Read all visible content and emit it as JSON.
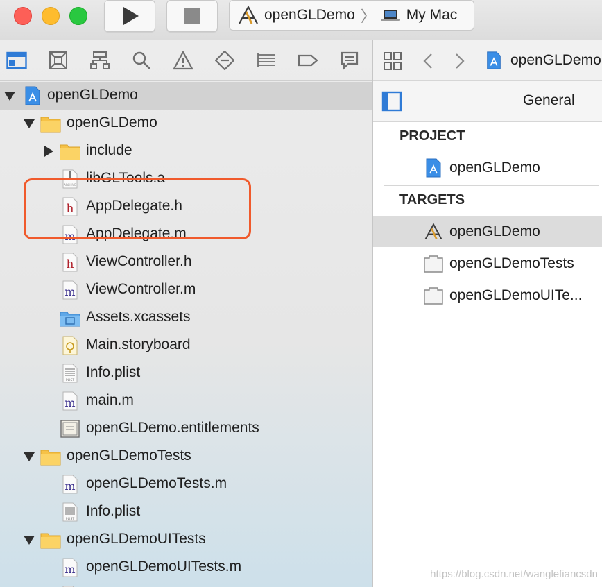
{
  "toolbar": {
    "scheme_target": "openGLDemo",
    "scheme_device": "My Mac"
  },
  "navigator": {
    "tab_icons": [
      "project-navigator-icon",
      "source-control-icon",
      "symbol-navigator-icon",
      "find-navigator-icon",
      "issue-navigator-icon",
      "test-navigator-icon",
      "debug-navigator-icon",
      "breakpoint-navigator-icon",
      "report-navigator-icon"
    ],
    "rows": [
      {
        "label": "openGLDemo",
        "icon": "project-file-icon"
      },
      {
        "label": "openGLDemo",
        "icon": "folder-icon"
      },
      {
        "label": "include",
        "icon": "folder-icon"
      },
      {
        "label": "libGLTools.a",
        "icon": "archive-file-icon"
      },
      {
        "label": "AppDelegate.h",
        "icon": "header-file-icon"
      },
      {
        "label": "AppDelegate.m",
        "icon": "objc-file-icon"
      },
      {
        "label": "ViewController.h",
        "icon": "header-file-icon"
      },
      {
        "label": "ViewController.m",
        "icon": "objc-file-icon"
      },
      {
        "label": "Assets.xcassets",
        "icon": "asset-catalog-icon"
      },
      {
        "label": "Main.storyboard",
        "icon": "storyboard-icon"
      },
      {
        "label": "Info.plist",
        "icon": "plist-file-icon"
      },
      {
        "label": "main.m",
        "icon": "objc-file-icon"
      },
      {
        "label": "openGLDemo.entitlements",
        "icon": "entitlements-file-icon"
      },
      {
        "label": "openGLDemoTests",
        "icon": "folder-icon"
      },
      {
        "label": "openGLDemoTests.m",
        "icon": "objc-file-icon"
      },
      {
        "label": "Info.plist",
        "icon": "plist-file-icon"
      },
      {
        "label": "openGLDemoUITests",
        "icon": "folder-icon"
      },
      {
        "label": "openGLDemoUITests.m",
        "icon": "objc-file-icon"
      }
    ]
  },
  "editor": {
    "jumpbar_file": "openGLDemo",
    "tab_general": "General",
    "project_header": "PROJECT",
    "project_item": "openGLDemo",
    "targets_header": "TARGETS",
    "targets": [
      "openGLDemo",
      "openGLDemoTests",
      "openGLDemoUITe..."
    ]
  },
  "watermark": "https://blog.csdn.net/wanglefiancsdn",
  "colors": {
    "highlight_box": "#f05a2c",
    "selection": "#d2d2d2",
    "accent_blue": "#2f7bd6"
  }
}
